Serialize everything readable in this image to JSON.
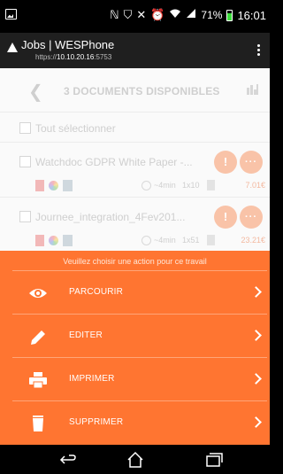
{
  "status_bar": {
    "icons": [
      "nfc-icon",
      "vpn-icon",
      "mute-icon",
      "alarm-icon",
      "wifi-icon",
      "signal-icon"
    ],
    "battery_percent": "71%",
    "battery_level": 0.71,
    "time": "16:01"
  },
  "app_bar": {
    "title": "Jobs | WESPhone",
    "url_scheme": "https://",
    "url_host": "10.10.20.16",
    "url_port": ":5753"
  },
  "page": {
    "header_title": "3 DOCUMENTS DISPONIBLES",
    "select_all_label": "Tout sélectionner",
    "documents": [
      {
        "name": "Watchdoc GDPR White Paper -...",
        "duration": "~4min",
        "copies": "1x10",
        "price": "7.01€"
      },
      {
        "name": "Journee_integration_4Fev201...",
        "duration": "~4min",
        "copies": "1x51",
        "price": "23.21€"
      }
    ]
  },
  "sheet": {
    "prompt": "Veuillez choisir une action pour ce travail",
    "actions": [
      {
        "label": "PARCOURIR",
        "icon": "eye-icon"
      },
      {
        "label": "EDITER",
        "icon": "pencil-icon"
      },
      {
        "label": "IMPRIMER",
        "icon": "printer-icon"
      },
      {
        "label": "SUPPRIMER",
        "icon": "trash-icon"
      }
    ]
  },
  "colors": {
    "accent": "#ff7531",
    "status_bar_bg": "#000000",
    "app_bar_bg": "#1f1f1f"
  }
}
